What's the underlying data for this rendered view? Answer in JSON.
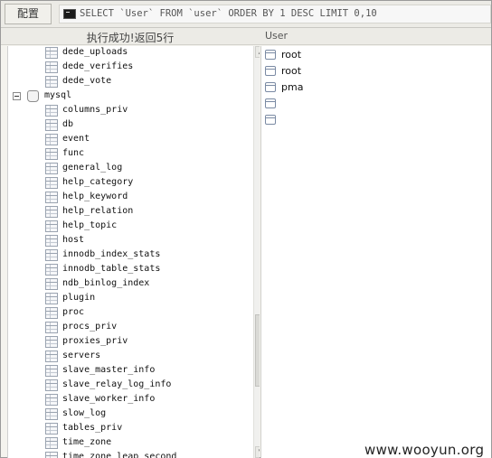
{
  "toolbar": {
    "config_label": "配置",
    "console_icon": "console-icon",
    "sql": "SELECT `User` FROM `user` ORDER BY 1 DESC LIMIT 0,10"
  },
  "status": {
    "message": "执行成功!返回5行",
    "column_header": "User"
  },
  "tree": {
    "items_before": [
      "dede_uploads",
      "dede_verifies",
      "dede_vote"
    ],
    "database": "mysql",
    "database_icons": [
      "collapse-icon",
      "database-icon"
    ],
    "tables": [
      "columns_priv",
      "db",
      "event",
      "func",
      "general_log",
      "help_category",
      "help_keyword",
      "help_relation",
      "help_topic",
      "host",
      "innodb_index_stats",
      "innodb_table_stats",
      "ndb_binlog_index",
      "plugin",
      "proc",
      "procs_priv",
      "proxies_priv",
      "servers",
      "slave_master_info",
      "slave_relay_log_info",
      "slave_worker_info",
      "slow_log",
      "tables_priv",
      "time_zone",
      "time_zone_leap_second"
    ],
    "table_icon": "table-icon"
  },
  "results": {
    "rows": [
      "root",
      "root",
      "pma",
      "",
      ""
    ],
    "row_icon": "cell-icon"
  },
  "watermark": "www.wooyun.org"
}
